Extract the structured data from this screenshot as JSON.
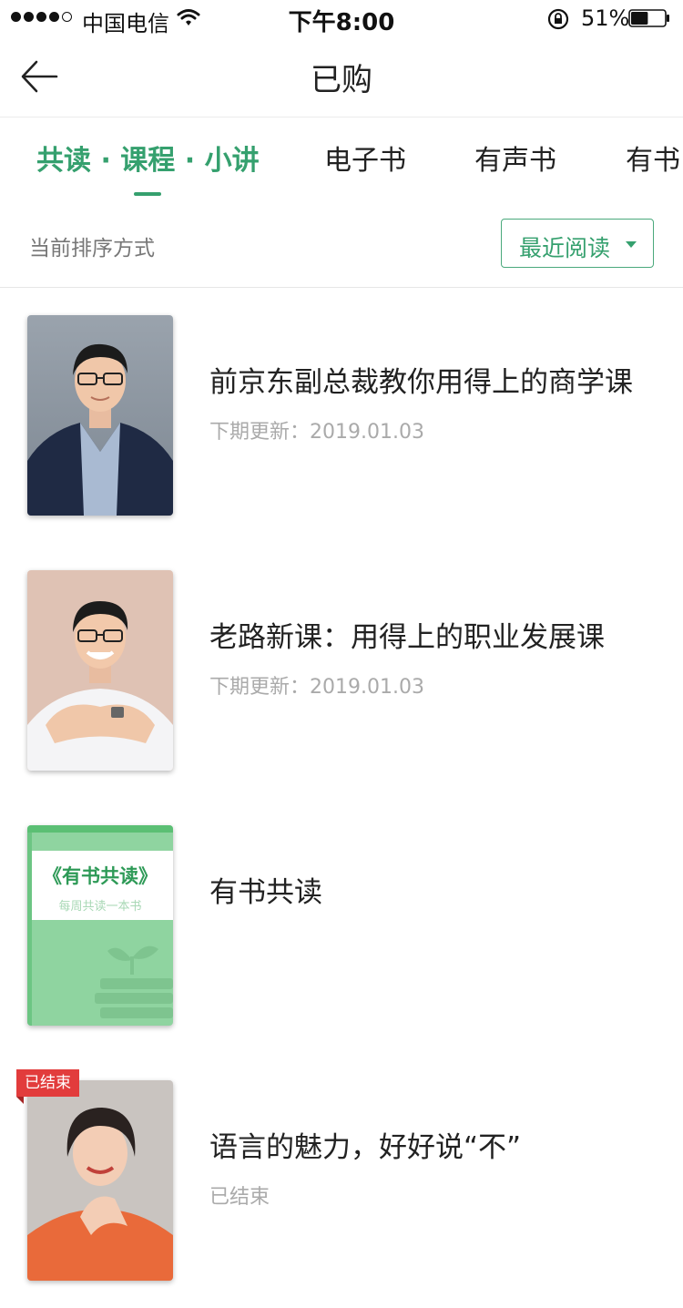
{
  "status_bar": {
    "carrier": "中国电信",
    "time": "下午8:00",
    "battery": "51%",
    "battery_level": 0.51,
    "signal_bars": 4,
    "signal_max": 5
  },
  "nav": {
    "title": "已购",
    "back_icon": "arrow-left-icon"
  },
  "tabs": [
    {
      "label": "共读 · 课程 · 小讲",
      "active": true
    },
    {
      "label": "电子书",
      "active": false
    },
    {
      "label": "有声书",
      "active": false
    },
    {
      "label": "有书",
      "active": false
    }
  ],
  "sort": {
    "label": "当前排序方式",
    "selected": "最近阅读"
  },
  "items": [
    {
      "title": "前京东副总裁教你用得上的商学课",
      "subtitle": "下期更新：2019.01.03",
      "cover": "portrait-man-suit"
    },
    {
      "title": "老路新课：用得上的职业发展课",
      "subtitle": "下期更新：2019.01.03",
      "cover": "portrait-man-shirt"
    },
    {
      "title": "有书共读",
      "subtitle": "",
      "cover_title": "《有书共读》",
      "cover_subtitle": "每周共读一本书"
    },
    {
      "title": "语言的魅力，好好说“不”",
      "subtitle": "已结束",
      "badge": "已结束",
      "cover": "portrait-woman"
    }
  ],
  "colors": {
    "accent": "#35a06e",
    "badge_red": "#e23c3c",
    "muted_text": "#aaaaaa"
  }
}
